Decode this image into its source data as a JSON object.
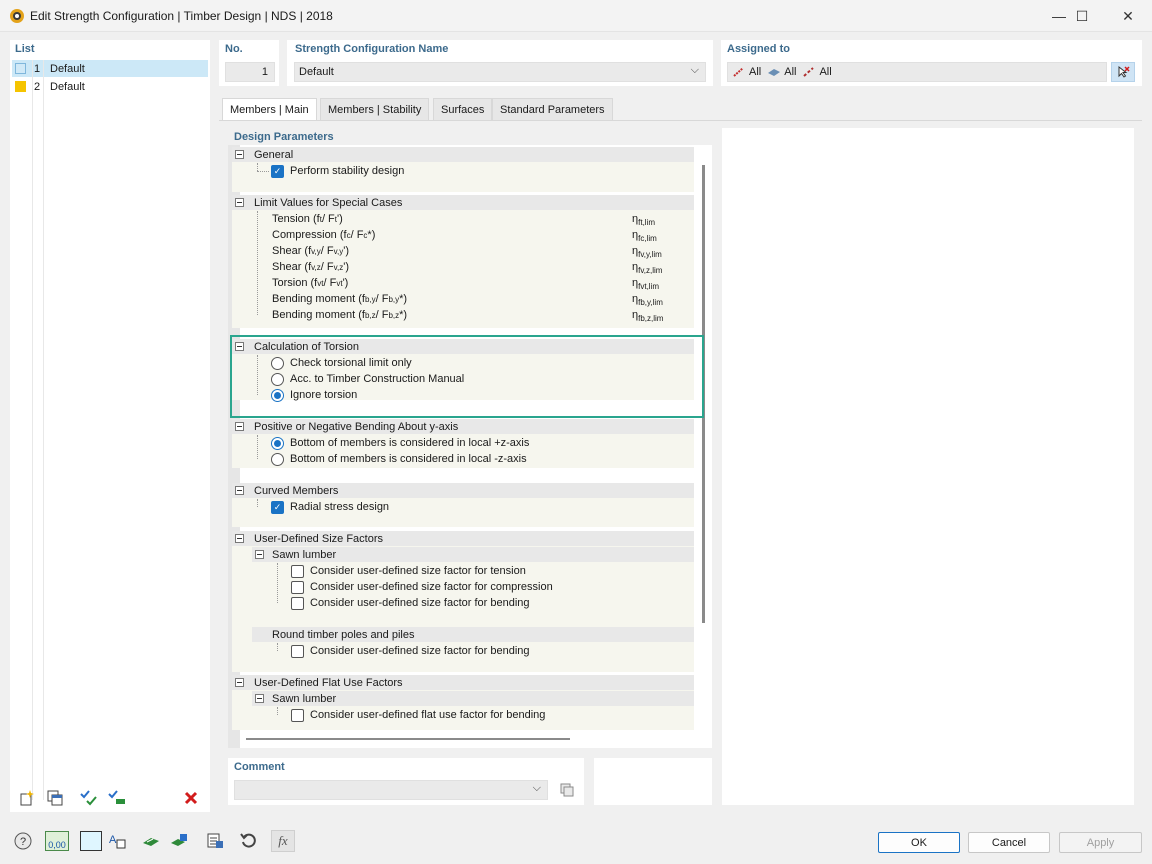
{
  "window": {
    "title": "Edit Strength Configuration | Timber Design | NDS | 2018",
    "minimize": "—",
    "maximize": "☐",
    "close": "✕"
  },
  "list": {
    "label": "List",
    "items": [
      {
        "num": "1",
        "name": "Default",
        "color": "#d0e9f7"
      },
      {
        "num": "2",
        "name": "Default",
        "color": "#f5c400"
      }
    ]
  },
  "header": {
    "no_label": "No.",
    "no_value": "1",
    "name_label": "Strength Configuration Name",
    "name_value": "Default",
    "assigned_label": "Assigned to",
    "assigned_items": [
      "All",
      "All",
      "All"
    ]
  },
  "tabs": [
    "Members | Main",
    "Members | Stability",
    "Surfaces",
    "Standard Parameters"
  ],
  "design_parameters": {
    "label": "Design Parameters",
    "general": {
      "title": "General",
      "perform_stability": "Perform stability design"
    },
    "limit_values": {
      "title": "Limit Values for Special Cases",
      "rows": [
        {
          "label": "Tension (f",
          "sub1": "t",
          "mid": " / F",
          "sub2": "t",
          "end": "')",
          "eta": "η",
          "eta_sub": "ft,lim"
        },
        {
          "label": "Compression (f",
          "sub1": "c",
          "mid": " / F",
          "sub2": "c",
          "end": "*)",
          "eta": "η",
          "eta_sub": "fc,lim"
        },
        {
          "label": "Shear (f",
          "sub1": "v,y",
          "mid": " / F",
          "sub2": "v,y",
          "end": "')",
          "eta": "η",
          "eta_sub": "fv,y,lim"
        },
        {
          "label": "Shear (f",
          "sub1": "v,z",
          "mid": " / F",
          "sub2": "v,z",
          "end": "')",
          "eta": "η",
          "eta_sub": "fv,z,lim"
        },
        {
          "label": "Torsion (f",
          "sub1": "vt",
          "mid": " / F",
          "sub2": "vt",
          "end": "')",
          "eta": "η",
          "eta_sub": "fvt,lim"
        },
        {
          "label": "Bending moment (f",
          "sub1": "b,y",
          "mid": " / F",
          "sub2": "b,y",
          "end": "*)",
          "eta": "η",
          "eta_sub": "fb,y,lim"
        },
        {
          "label": "Bending moment (f",
          "sub1": "b,z",
          "mid": " / F",
          "sub2": "b,z",
          "end": "*)",
          "eta": "η",
          "eta_sub": "fb,z,lim"
        }
      ]
    },
    "torsion": {
      "title": "Calculation of Torsion",
      "options": [
        "Check torsional limit only",
        "Acc. to Timber Construction Manual",
        "Ignore torsion"
      ],
      "selected": 2
    },
    "bending": {
      "title": "Positive or Negative Bending About y-axis",
      "options": [
        "Bottom of members is considered in local +z-axis",
        "Bottom of members is considered in local -z-axis"
      ],
      "selected": 0
    },
    "curved": {
      "title": "Curved Members",
      "radial": "Radial stress design"
    },
    "size_factors": {
      "title": "User-Defined Size Factors",
      "sawn": "Sawn lumber",
      "sawn_items": [
        "Consider user-defined size factor for tension",
        "Consider user-defined size factor for compression",
        "Consider user-defined size factor for bending"
      ],
      "round": "Round timber poles and piles",
      "round_items": [
        "Consider user-defined size factor for bending"
      ]
    },
    "flat_use": {
      "title": "User-Defined Flat Use Factors",
      "sawn": "Sawn lumber",
      "items": [
        "Consider user-defined flat use factor for bending"
      ]
    }
  },
  "comment": {
    "label": "Comment",
    "value": ""
  },
  "buttons": {
    "ok": "OK",
    "cancel": "Cancel",
    "apply": "Apply"
  },
  "icons": {
    "zero_label": "0,00"
  }
}
